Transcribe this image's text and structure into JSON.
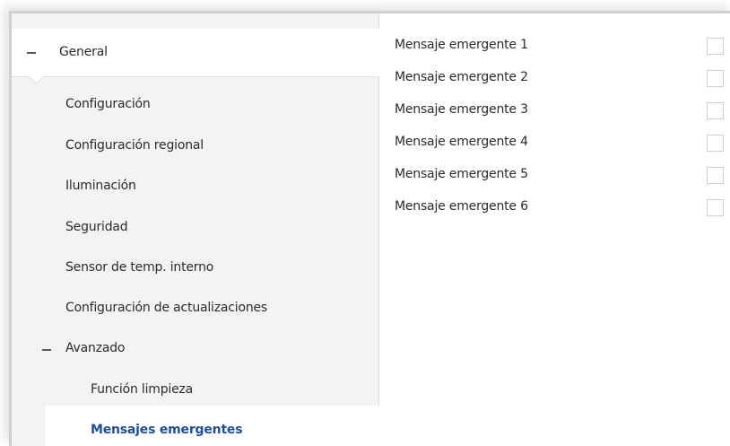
{
  "tree": {
    "general": {
      "label": "General",
      "toggle": "−"
    },
    "children": [
      {
        "label": "Configuración"
      },
      {
        "label": "Configuración regional"
      },
      {
        "label": "Iluminación"
      },
      {
        "label": "Seguridad"
      },
      {
        "label": "Sensor de temp. interno"
      },
      {
        "label": "Configuración de actualizaciones"
      }
    ],
    "advanced": {
      "label": "Avanzado",
      "toggle": "−",
      "children": [
        {
          "label": "Función limpieza"
        },
        {
          "label": "Mensajes emergentes",
          "selected": true
        }
      ]
    }
  },
  "panel": {
    "params": [
      {
        "label": "Mensaje emergente 1",
        "checked": false
      },
      {
        "label": "Mensaje emergente 2",
        "checked": false
      },
      {
        "label": "Mensaje emergente 3",
        "checked": false
      },
      {
        "label": "Mensaje emergente 4",
        "checked": false
      },
      {
        "label": "Mensaje emergente 5",
        "checked": false
      },
      {
        "label": "Mensaje emergente 6",
        "checked": false
      }
    ]
  },
  "colors": {
    "selected_text": "#1f4e96",
    "tree_background": "#f3f3f3",
    "border": "#cfcfcf"
  }
}
